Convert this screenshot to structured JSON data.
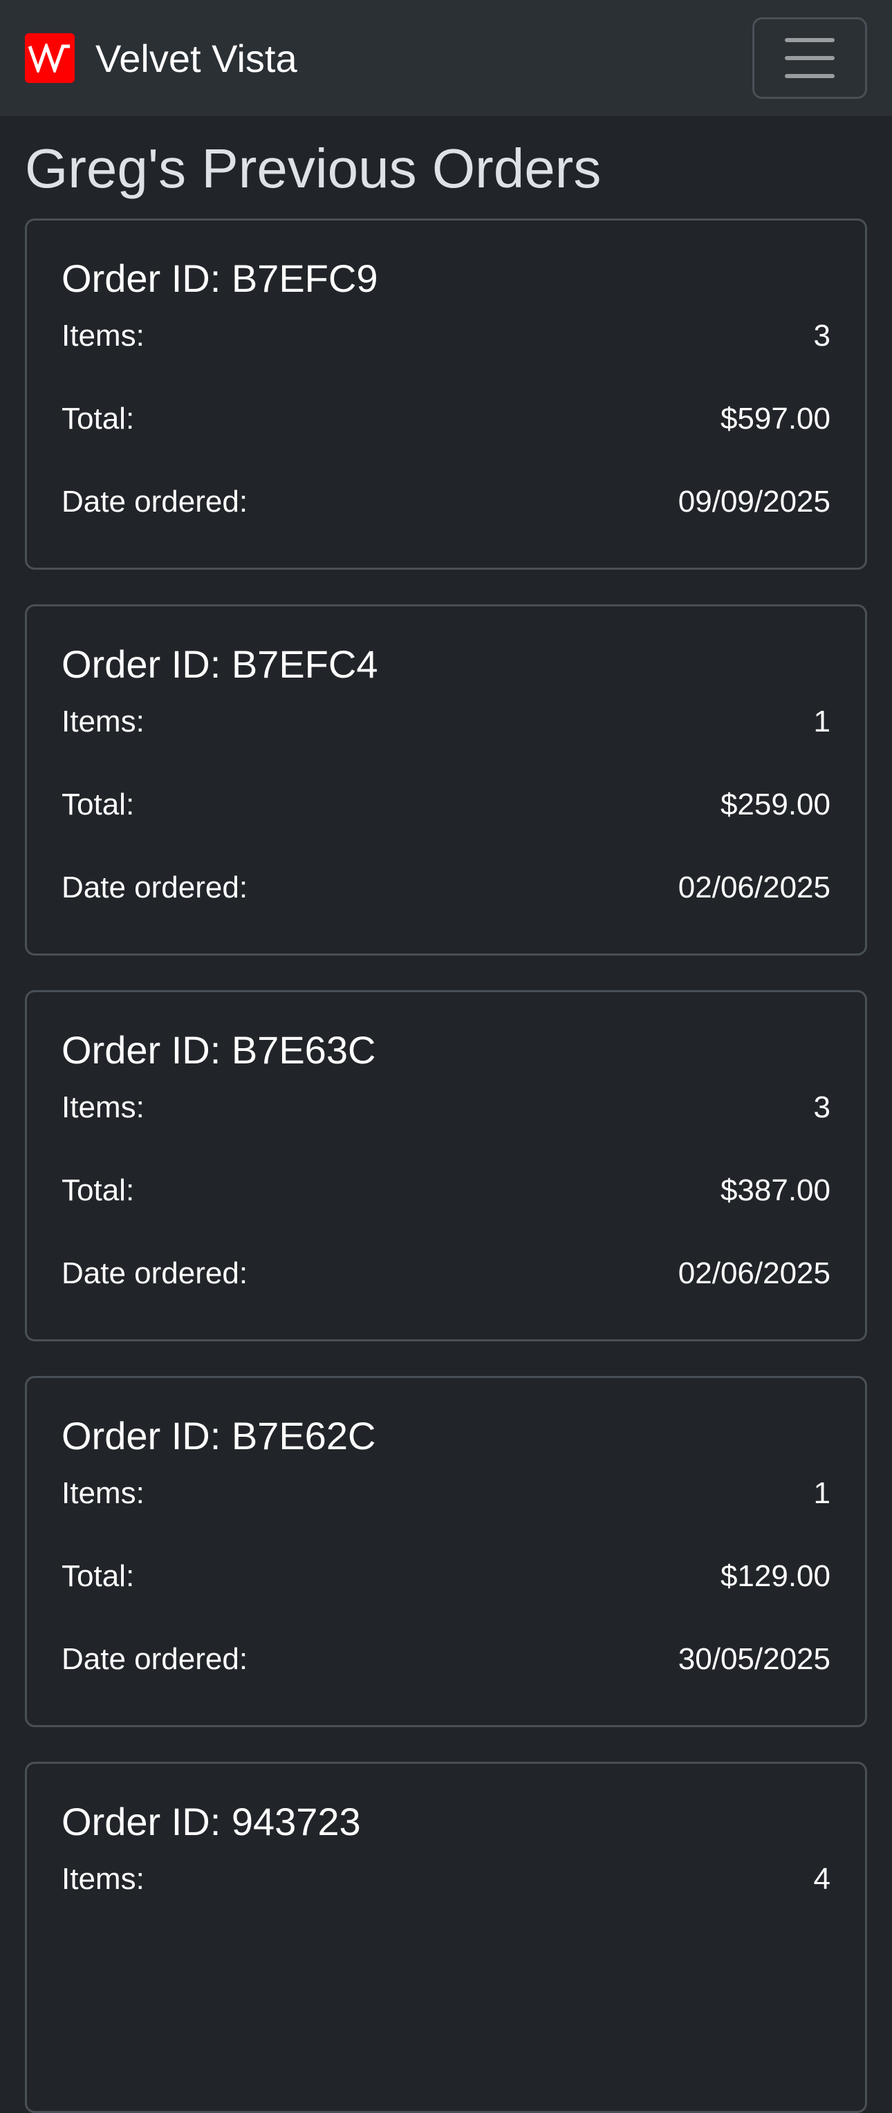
{
  "nav": {
    "brand": "Velvet Vista",
    "logo_icon": "vv-logo-icon",
    "accent": "#ff0000"
  },
  "page": {
    "title": "Greg's Previous Orders"
  },
  "labels": {
    "id": "Order ID: ",
    "items": "Items:",
    "total": "Total:",
    "date": "Date ordered:"
  },
  "orders": [
    {
      "id": "B7EFC9",
      "items": "3",
      "total": "$597.00",
      "date": "09/09/2025"
    },
    {
      "id": "B7EFC4",
      "items": "1",
      "total": "$259.00",
      "date": "02/06/2025"
    },
    {
      "id": "B7E63C",
      "items": "3",
      "total": "$387.00",
      "date": "02/06/2025"
    },
    {
      "id": "B7E62C",
      "items": "1",
      "total": "$129.00",
      "date": "30/05/2025"
    },
    {
      "id": "943723",
      "items": "4"
    }
  ]
}
